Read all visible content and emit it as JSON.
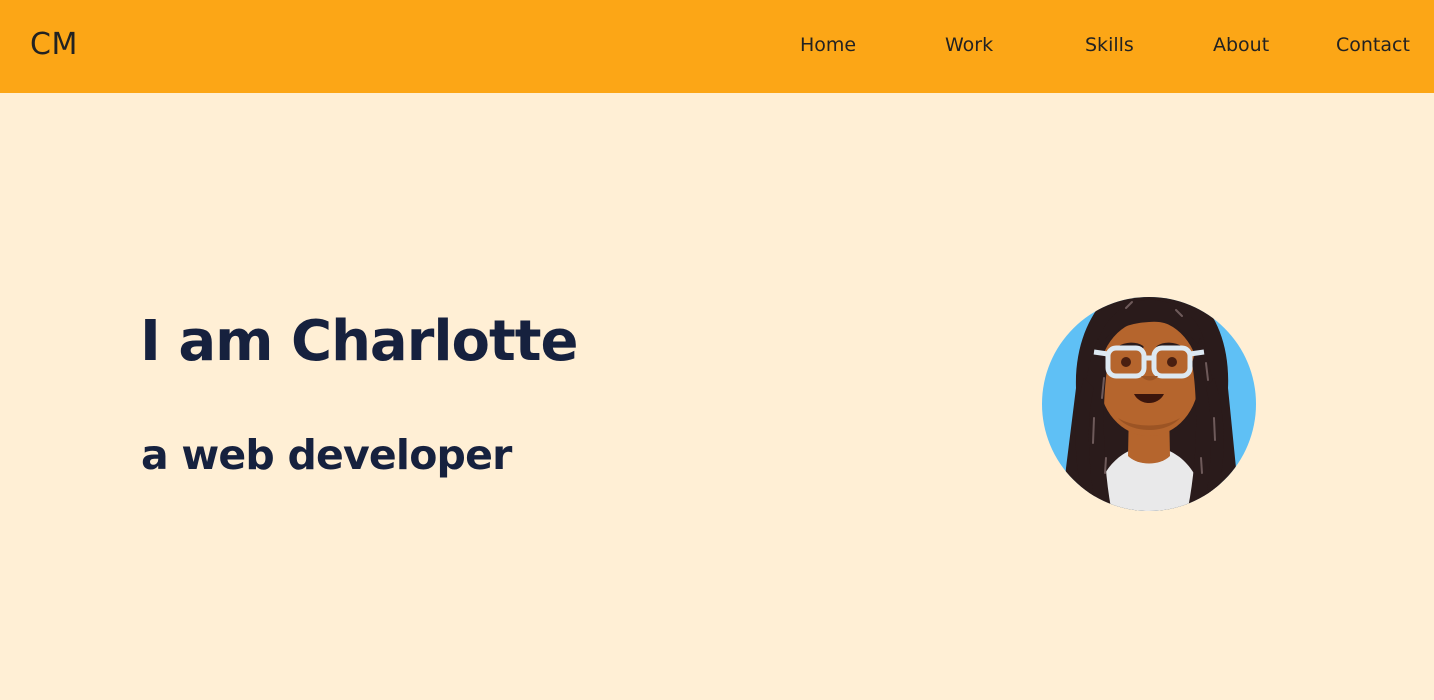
{
  "header": {
    "logo": "CM",
    "nav": [
      {
        "label": "Home"
      },
      {
        "label": "Work"
      },
      {
        "label": "Skills"
      },
      {
        "label": "About"
      },
      {
        "label": "Contact"
      }
    ]
  },
  "hero": {
    "title": "I am Charlotte",
    "subtitle": "a web developer",
    "avatar_icon": "avatar-illustration"
  },
  "colors": {
    "header_bg": "#fca616",
    "page_bg": "#ffefd5",
    "heading_text": "#16213e",
    "nav_text": "#222222",
    "avatar_circle": "#5fc0f5"
  }
}
